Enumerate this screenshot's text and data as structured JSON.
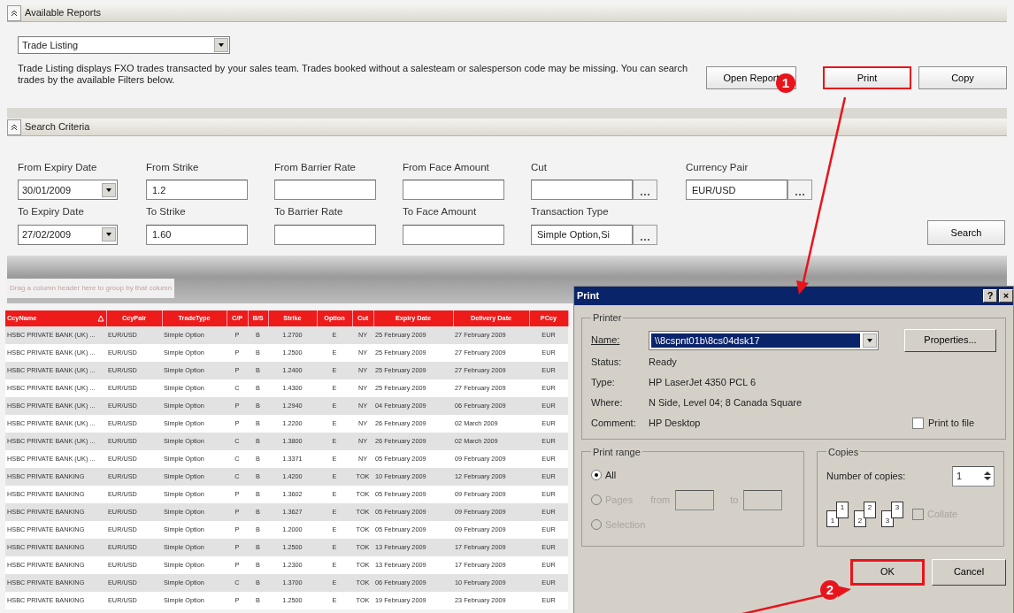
{
  "available_reports": {
    "title": "Available Reports",
    "report": "Trade Listing",
    "description": "Trade Listing displays FXO trades transacted by your sales team. Trades booked without a salesteam or salesperson code may be missing. You can search trades by the available Filters below.",
    "buttons": [
      {
        "label": "Open Report",
        "highlighted": false
      },
      {
        "label": "Print",
        "highlighted": true
      },
      {
        "label": "Copy",
        "highlighted": false
      }
    ]
  },
  "search_criteria": {
    "title": "Search Criteria",
    "rows": [
      [
        {
          "label": "From Expiry Date",
          "kind": "date",
          "value": "30/01/2009"
        },
        {
          "label": "From Strike",
          "kind": "text",
          "value": "1.2"
        },
        {
          "label": "From Barrier Rate",
          "kind": "text"
        },
        {
          "label": "From Face Amount",
          "kind": "text"
        },
        {
          "label": "Cut",
          "kind": "picker"
        },
        {
          "label": "Currency Pair",
          "kind": "picker",
          "value": "EUR/USD"
        }
      ],
      [
        {
          "label": "To Expiry Date",
          "kind": "date",
          "value": "27/02/2009"
        },
        {
          "label": "To Strike",
          "kind": "text",
          "value": "1.60"
        },
        {
          "label": "To Barrier Rate",
          "kind": "text"
        },
        {
          "label": "To Face Amount",
          "kind": "text"
        },
        {
          "label": "Transaction Type",
          "kind": "picker",
          "value": "Simple Option,Si"
        }
      ]
    ],
    "button": "Search"
  },
  "grid": {
    "group_hint": "Drag a column header here to group by that column",
    "columns": [
      {
        "label": "CcyName",
        "sorted": true
      },
      {
        "label": "CcyPair",
        "sorted": false
      },
      {
        "label": "TradeType",
        "sorted": false
      },
      {
        "label": "C/P",
        "sorted": false
      },
      {
        "label": "B/S",
        "sorted": false
      },
      {
        "label": "Strike",
        "sorted": false
      },
      {
        "label": "Option",
        "sorted": false
      },
      {
        "label": "Cut",
        "sorted": false
      },
      {
        "label": "Expiry Date",
        "sorted": false
      },
      {
        "label": "Delivery Date",
        "sorted": false
      },
      {
        "label": "PCcy",
        "sorted": false
      }
    ],
    "rows": [
      [
        "HSBC PRIVATE BANK (UK) ...",
        "EUR/USD",
        "Simple Option",
        "P",
        "B",
        "1.2700",
        "E",
        "NY",
        "25 February 2009",
        "27 February 2009",
        "EUR"
      ],
      [
        "HSBC PRIVATE BANK (UK) ...",
        "EUR/USD",
        "Simple Option",
        "P",
        "B",
        "1.2500",
        "E",
        "NY",
        "25 February 2009",
        "27 February 2009",
        "EUR"
      ],
      [
        "HSBC PRIVATE BANK (UK) ...",
        "EUR/USD",
        "Simple Option",
        "P",
        "B",
        "1.2400",
        "E",
        "NY",
        "25 February 2009",
        "27 February 2009",
        "EUR"
      ],
      [
        "HSBC PRIVATE BANK (UK) ...",
        "EUR/USD",
        "Simple Option",
        "C",
        "B",
        "1.4300",
        "E",
        "NY",
        "25 February 2009",
        "27 February 2009",
        "EUR"
      ],
      [
        "HSBC PRIVATE BANK (UK) ...",
        "EUR/USD",
        "Simple Option",
        "P",
        "B",
        "1.2940",
        "E",
        "NY",
        "04 February 2009",
        "06 February 2009",
        "EUR"
      ],
      [
        "HSBC PRIVATE BANK (UK) ...",
        "EUR/USD",
        "Simple Option",
        "P",
        "B",
        "1.2200",
        "E",
        "NY",
        "26 February 2009",
        "02 March 2009",
        "EUR"
      ],
      [
        "HSBC PRIVATE BANK (UK) ...",
        "EUR/USD",
        "Simple Option",
        "C",
        "B",
        "1.3800",
        "E",
        "NY",
        "26 February 2009",
        "02 March 2009",
        "EUR"
      ],
      [
        "HSBC PRIVATE BANK (UK) ...",
        "EUR/USD",
        "Simple Option",
        "C",
        "B",
        "1.3371",
        "E",
        "NY",
        "05 February 2009",
        "09 February 2009",
        "EUR"
      ],
      [
        "HSBC PRIVATE BANKING",
        "EUR/USD",
        "Simple Option",
        "C",
        "B",
        "1.4200",
        "E",
        "TOK",
        "10 February 2009",
        "12 February 2009",
        "EUR"
      ],
      [
        "HSBC PRIVATE BANKING",
        "EUR/USD",
        "Simple Option",
        "P",
        "B",
        "1.3602",
        "E",
        "TOK",
        "05 February 2009",
        "09 February 2009",
        "EUR"
      ],
      [
        "HSBC PRIVATE BANKING",
        "EUR/USD",
        "Simple Option",
        "P",
        "B",
        "1.3627",
        "E",
        "TOK",
        "05 February 2009",
        "09 February 2009",
        "EUR"
      ],
      [
        "HSBC PRIVATE BANKING",
        "EUR/USD",
        "Simple Option",
        "P",
        "B",
        "1.2000",
        "E",
        "TOK",
        "05 February 2009",
        "09 February 2009",
        "EUR"
      ],
      [
        "HSBC PRIVATE BANKING",
        "EUR/USD",
        "Simple Option",
        "P",
        "B",
        "1.2500",
        "E",
        "TOK",
        "13 February 2009",
        "17 February 2009",
        "EUR"
      ],
      [
        "HSBC PRIVATE BANKING",
        "EUR/USD",
        "Simple Option",
        "P",
        "B",
        "1.2300",
        "E",
        "TOK",
        "13 February 2009",
        "17 February 2009",
        "EUR"
      ],
      [
        "HSBC PRIVATE BANKING",
        "EUR/USD",
        "Simple Option",
        "C",
        "B",
        "1.3700",
        "E",
        "TOK",
        "06 February 2009",
        "10 February 2009",
        "EUR"
      ],
      [
        "HSBC PRIVATE BANKING",
        "EUR/USD",
        "Simple Option",
        "P",
        "B",
        "1.2500",
        "E",
        "TOK",
        "19 February 2009",
        "23 February 2009",
        "EUR"
      ]
    ]
  },
  "print_dialog": {
    "title": "Print",
    "title_buttons": [
      "?",
      "×"
    ],
    "printer": {
      "legend": "Printer",
      "name_label": "Name:",
      "name": "\\\\8cspnt01b\\8cs04dsk17",
      "properties": "Properties...",
      "info": [
        {
          "label": "Status:",
          "value": "Ready"
        },
        {
          "label": "Type:",
          "value": "HP LaserJet 4350 PCL 6"
        },
        {
          "label": "Where:",
          "value": "N Side, Level 04; 8 Canada Square"
        },
        {
          "label": "Comment:",
          "value": "HP Desktop"
        }
      ],
      "print_to_file": {
        "label": "Print to file",
        "checked": false
      }
    },
    "print_range": {
      "legend": "Print range",
      "options": [
        {
          "label": "All",
          "selected": true,
          "disabled": false
        },
        {
          "label": "Pages",
          "selected": false,
          "disabled": true
        },
        {
          "label": "Selection",
          "selected": false,
          "disabled": true
        }
      ],
      "from": "from",
      "to": "to"
    },
    "copies": {
      "legend": "Copies",
      "label": "Number of copies:",
      "value": "1",
      "page_numbers": [
        "1",
        "1",
        "2",
        "2",
        "3",
        "3"
      ],
      "collate": {
        "label": "Collate",
        "checked": false,
        "disabled": true
      }
    },
    "buttons": [
      {
        "label": "OK",
        "highlighted": true
      },
      {
        "label": "Cancel",
        "highlighted": false
      }
    ]
  },
  "annotations": [
    {
      "number": "1"
    },
    {
      "number": "2"
    }
  ]
}
